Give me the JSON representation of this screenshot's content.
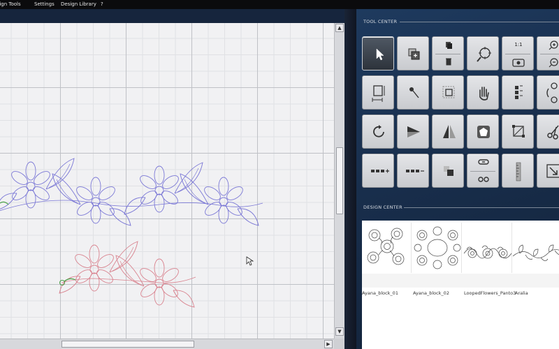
{
  "menu": {
    "items": [
      "Design Tools",
      "Settings",
      "Design Library",
      "?"
    ]
  },
  "tool_center": {
    "title": "TOOL CENTER",
    "ratio_label": "1:1",
    "tools": [
      {
        "name": "select-arrow-icon"
      },
      {
        "name": "add-design-icon"
      },
      {
        "name": "copy-delete-icon"
      },
      {
        "name": "zoom-target-icon"
      },
      {
        "name": "ratio-view-icon"
      },
      {
        "name": "zoom-in-out-icon"
      },
      {
        "name": "resize-box-icon"
      },
      {
        "name": "pin-needle-icon"
      },
      {
        "name": "crop-box-icon"
      },
      {
        "name": "hand-pan-icon"
      },
      {
        "name": "align-stack-icon"
      },
      {
        "name": "rotate-nodes-icon"
      },
      {
        "name": "rotate-icon"
      },
      {
        "name": "flip-icon"
      },
      {
        "name": "mirror-icon"
      },
      {
        "name": "pentagon-shape-icon"
      },
      {
        "name": "node-box-icon"
      },
      {
        "name": "scissors-icon"
      },
      {
        "name": "add-stitches-icon"
      },
      {
        "name": "remove-stitches-icon"
      },
      {
        "name": "layer-order-icon"
      },
      {
        "name": "link-unlink-icon"
      },
      {
        "name": "ruler-icon"
      },
      {
        "name": "corner-arrow-icon"
      }
    ]
  },
  "design_center": {
    "title": "DESIGN CENTER",
    "designs": [
      {
        "label": "Ayana_block_01"
      },
      {
        "label": "Ayana_block_02"
      },
      {
        "label": "LoopedFlowers_Panto3"
      },
      {
        "label": "Aralia"
      }
    ]
  },
  "colors": {
    "design_blue": "#7b78d6",
    "design_red": "#d9838f",
    "panel_blue": "#1e3a5e"
  }
}
